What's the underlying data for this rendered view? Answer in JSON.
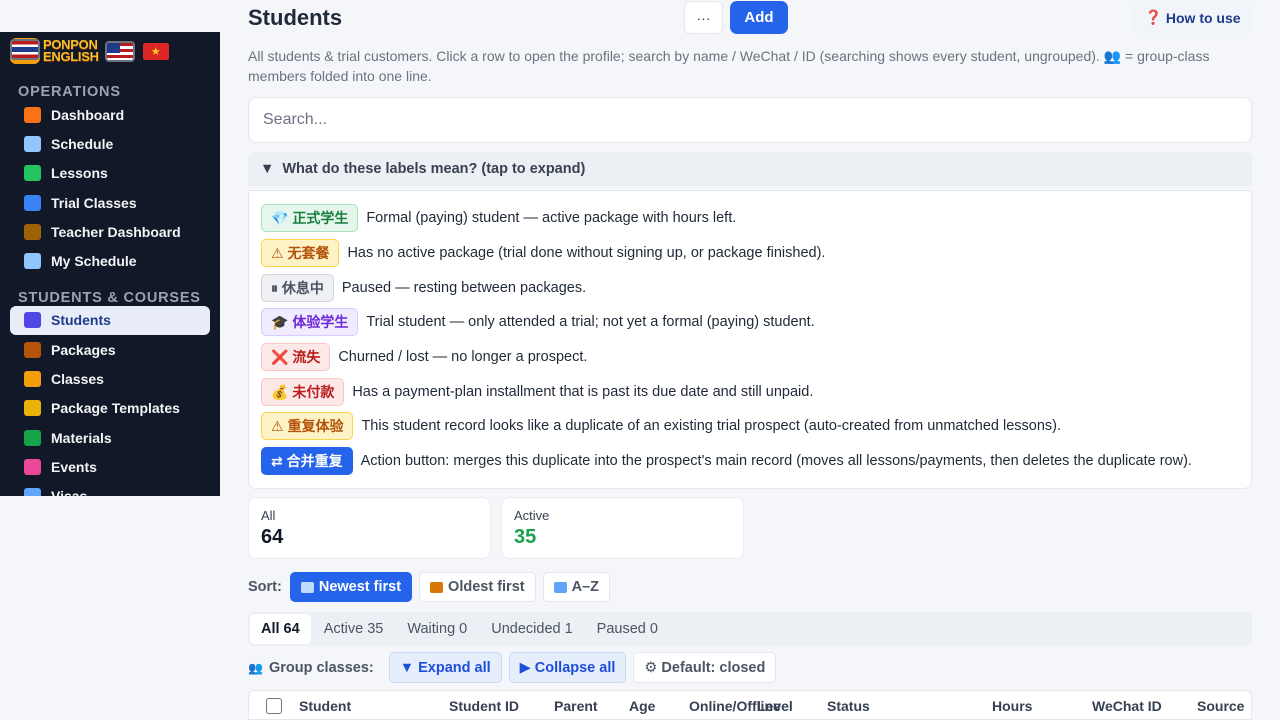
{
  "brand": {
    "logo_text_line1": "PONPON",
    "logo_text_line2": "ENGLISH",
    "logo_icon": "ponpon-mascot-logo",
    "flags": [
      "us-flag-icon",
      "vietnam-flag-icon",
      "thailand-flag-icon"
    ]
  },
  "sidebar": {
    "sections": [
      {
        "title": "OPERATIONS",
        "items": [
          {
            "label": "Dashboard",
            "icon": "house-icon",
            "color": "#f97316"
          },
          {
            "label": "Schedule",
            "icon": "calendar-icon",
            "color": "#93c5fd"
          },
          {
            "label": "Lessons",
            "icon": "check-box-icon",
            "color": "#22c55e"
          },
          {
            "label": "Trial Classes",
            "icon": "magnifier-icon",
            "color": "#3b82f6"
          },
          {
            "label": "Teacher Dashboard",
            "icon": "teacher-icon",
            "color": "#a16207"
          },
          {
            "label": "My Schedule",
            "icon": "calendar-icon",
            "color": "#93c5fd"
          }
        ]
      },
      {
        "title": "STUDENTS & COURSES",
        "items": [
          {
            "label": "Students",
            "icon": "people-icon",
            "color": "#4f46e5",
            "active": true
          },
          {
            "label": "Packages",
            "icon": "package-icon",
            "color": "#b45309"
          },
          {
            "label": "Classes",
            "icon": "group-icon",
            "color": "#f59e0b"
          },
          {
            "label": "Package Templates",
            "icon": "folder-icon",
            "color": "#eab308"
          },
          {
            "label": "Materials",
            "icon": "books-icon",
            "color": "#16a34a"
          },
          {
            "label": "Events",
            "icon": "ticket-icon",
            "color": "#ec4899"
          },
          {
            "label": "Visas",
            "icon": "passport-icon",
            "color": "#60a5fa"
          }
        ]
      }
    ]
  },
  "header": {
    "title": "Students",
    "more_label": "···",
    "add_label": "Add",
    "help_label": "How to use",
    "help_icon": "question-icon"
  },
  "description": "All students & trial customers. Click a row to open the profile; search by name / WeChat / ID (searching shows every student, ungrouped). 👥 = group-class members folded into one line.",
  "search": {
    "placeholder": "Search..."
  },
  "legend": {
    "toggle_label": "What do these labels mean? (tap to expand)",
    "rows": [
      {
        "badge": "💎 正式学生",
        "style": "b-green",
        "text": "Formal (paying) student — active package with hours left."
      },
      {
        "badge": "⚠ 无套餐",
        "style": "b-amber",
        "text": "Has no active package (trial done without signing up, or package finished)."
      },
      {
        "badge": "⏸ 休息中",
        "style": "b-gray",
        "text": "Paused — resting between packages."
      },
      {
        "badge": "🎓 体验学生",
        "style": "b-purple",
        "text": "Trial student — only attended a trial; not yet a formal (paying) student."
      },
      {
        "badge": "❌ 流失",
        "style": "b-red",
        "text": "Churned / lost — no longer a prospect."
      },
      {
        "badge": "💰 未付款",
        "style": "b-red",
        "text": "Has a payment-plan installment that is past its due date and still unpaid."
      },
      {
        "badge": "⚠ 重复体验",
        "style": "b-amber",
        "text": "This student record looks like a duplicate of an existing trial prospect (auto-created from unmatched lessons)."
      },
      {
        "badge": "⇄ 合并重复",
        "style": "b-blue",
        "text": "Action button: merges this duplicate into the prospect's main record (moves all lessons/payments, then deletes the duplicate row)."
      }
    ]
  },
  "stats": [
    {
      "label": "All",
      "value": "64",
      "color": "#111827"
    },
    {
      "label": "Active",
      "value": "35",
      "color": "#16a34a"
    }
  ],
  "sort": {
    "label": "Sort:",
    "options": [
      {
        "label": "Newest first",
        "icon": "new-icon",
        "active": true
      },
      {
        "label": "Oldest first",
        "icon": "scroll-icon"
      },
      {
        "label": "A–Z",
        "icon": "abc-icon"
      }
    ]
  },
  "tabs": [
    "All 64",
    "Active 35",
    "Waiting 0",
    "Undecided 1",
    "Paused 0"
  ],
  "group": {
    "label": "Group classes:",
    "expand": "▼ Expand all",
    "collapse": "▶ Collapse all",
    "default": "⚙ Default: closed"
  },
  "table": {
    "columns": [
      "Student",
      "Student ID",
      "Parent",
      "Age",
      "Online/Offline",
      "Level",
      "Status",
      "Hours",
      "WeChat ID",
      "Source"
    ]
  }
}
